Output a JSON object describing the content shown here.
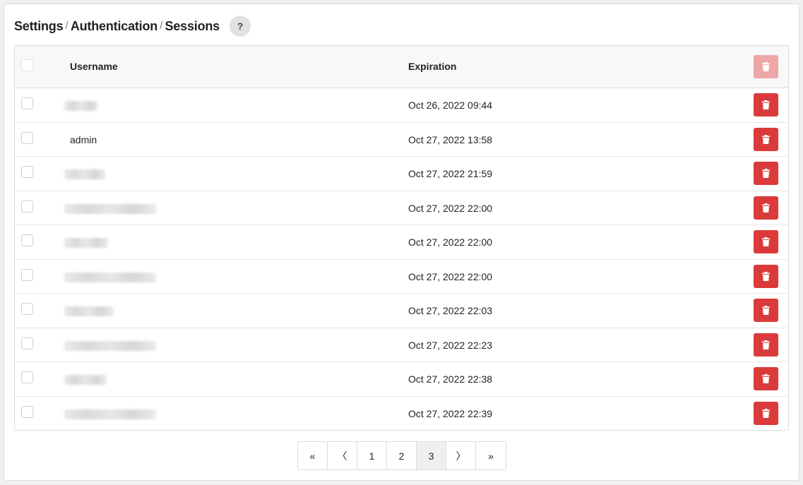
{
  "breadcrumb": {
    "items": [
      "Settings",
      "Authentication",
      "Sessions"
    ],
    "separator": "/"
  },
  "help": {
    "label": "?"
  },
  "table": {
    "columns": {
      "username": "Username",
      "expiration": "Expiration"
    },
    "rows": [
      {
        "username": "",
        "redacted": true,
        "expiration": "Oct 26, 2022 09:44"
      },
      {
        "username": "admin",
        "redacted": false,
        "expiration": "Oct 27, 2022 13:58"
      },
      {
        "username": "",
        "redacted": true,
        "expiration": "Oct 27, 2022 21:59"
      },
      {
        "username": "",
        "redacted": true,
        "expiration": "Oct 27, 2022 22:00"
      },
      {
        "username": "",
        "redacted": true,
        "expiration": "Oct 27, 2022 22:00"
      },
      {
        "username": "",
        "redacted": true,
        "expiration": "Oct 27, 2022 22:00"
      },
      {
        "username": "",
        "redacted": true,
        "expiration": "Oct 27, 2022 22:03"
      },
      {
        "username": "",
        "redacted": true,
        "expiration": "Oct 27, 2022 22:23"
      },
      {
        "username": "",
        "redacted": true,
        "expiration": "Oct 27, 2022 22:38"
      },
      {
        "username": "",
        "redacted": true,
        "expiration": "Oct 27, 2022 22:39"
      }
    ]
  },
  "pagination": {
    "first": "«",
    "prev": "〈",
    "pages": [
      "1",
      "2",
      "3"
    ],
    "current": "3",
    "next": "〉",
    "last": "»"
  },
  "colors": {
    "danger": "#db3a3a",
    "danger_disabled": "#eda7a7"
  },
  "icons": {
    "delete": "trash-icon",
    "help": "help-icon"
  }
}
